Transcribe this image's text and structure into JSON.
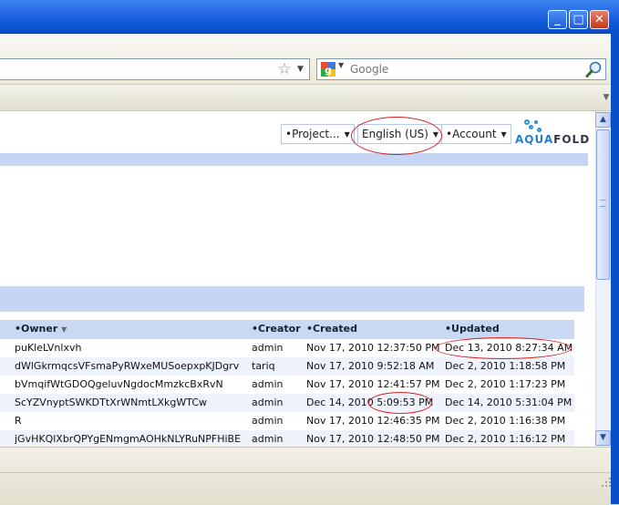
{
  "browser": {
    "search_placeholder": "Google",
    "icons": {
      "minimize": "minimize-icon",
      "maximize": "maximize-icon",
      "close": "close-icon",
      "bookmark": "star-icon",
      "search": "magnifier-icon",
      "search_engine": "google-icon"
    },
    "min_glyph": "_",
    "max_glyph": "□",
    "close_glyph": "✕"
  },
  "header": {
    "project_menu": "•Project...",
    "language_menu": "English (US)",
    "account_menu": "•Account",
    "logo_aqua": "AQUA",
    "logo_fold": "FOLD"
  },
  "grid": {
    "columns": {
      "owner": "•Owner",
      "creator": "•Creator",
      "created": "•Created",
      "updated": "•Updated"
    },
    "rows": [
      {
        "owner": "puKleLVnlxvh",
        "creator": "admin",
        "created": "Nov 17, 2010 12:37:50 PM",
        "updated": "Dec 13, 2010 8:27:34 AM"
      },
      {
        "owner": "dWlGkrmqcsVFsmaPyRWxeMUSoepxpKJDgrv",
        "creator": "tariq",
        "created": "Nov 17, 2010 9:52:18 AM",
        "updated": "Dec 2, 2010 1:18:58 PM"
      },
      {
        "owner": "bVmqifWtGDOQgeluvNgdocMmzkcBxRvN",
        "creator": "admin",
        "created": "Nov 17, 2010 12:41:57 PM",
        "updated": "Dec 2, 2010 1:17:23 PM"
      },
      {
        "owner": "ScYZVnyptSWKDTtXrWNmtLXkgWTCw",
        "creator": "admin",
        "created": "Dec 14, 2010 5:09:53 PM",
        "updated": "Dec 14, 2010 5:31:04 PM"
      },
      {
        "owner": "R",
        "creator": "admin",
        "created": "Nov 17, 2010 12:46:35 PM",
        "updated": "Dec 2, 2010 1:16:38 PM"
      },
      {
        "owner": "jGvHKQlXbrQPYgENmgmAOHkNLYRuNPFHiBE",
        "creator": "admin",
        "created": "Nov 17, 2010 12:48:50 PM",
        "updated": "Dec 2, 2010 1:16:12 PM"
      }
    ]
  },
  "colors": {
    "titlebar": "#0f58d6",
    "grid_header": "#c9d9f3",
    "section_bar": "#c6d6f2",
    "annotation": "#d42020"
  }
}
